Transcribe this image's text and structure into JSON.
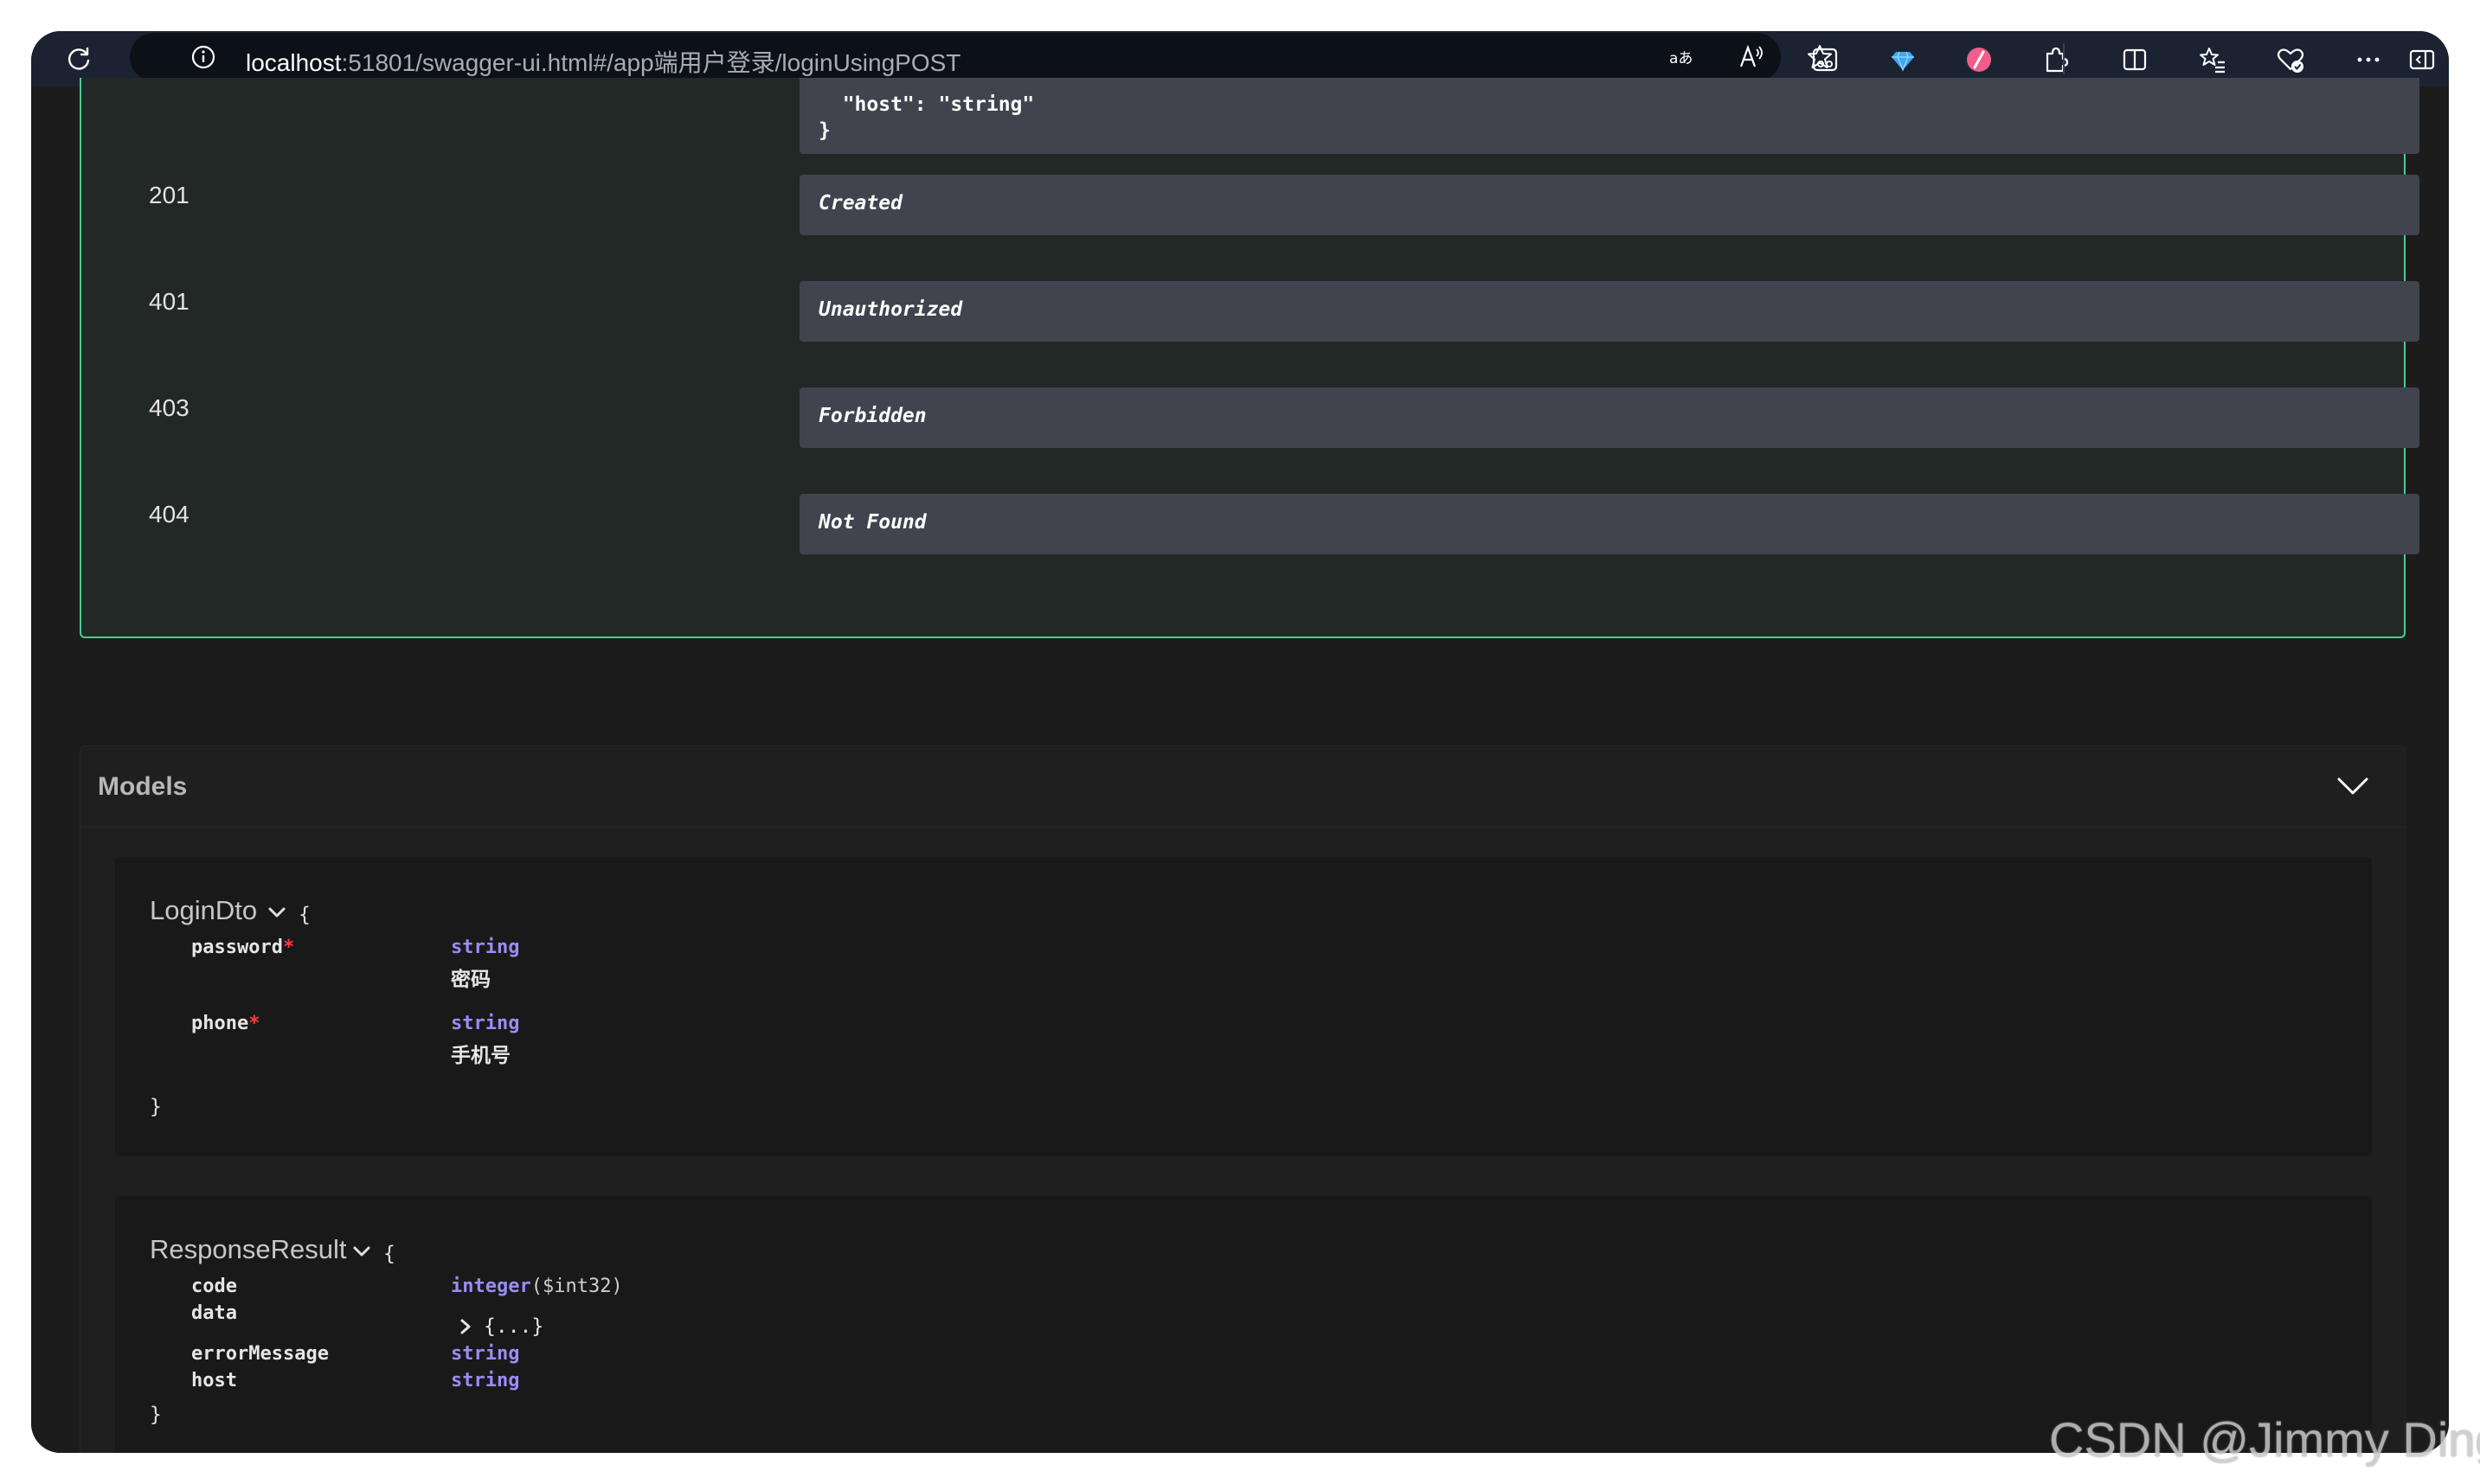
{
  "browser": {
    "url_host": "localhost",
    "url_rest": ":51801/swagger-ui.html#/app端用户登录/loginUsingPOST",
    "icons": [
      "refresh-icon",
      "site-info-icon",
      "translate-icon",
      "read-aloud-icon",
      "favorite-star-icon",
      "reading-mode-icon",
      "gem-extension-icon",
      "slash-extension-icon",
      "extensions-icon",
      "split-screen-icon",
      "favorites-icon",
      "browser-essentials-icon",
      "more-icon",
      "sidebar-icon"
    ]
  },
  "responses": {
    "example_tail": "  \"host\": \"string\"\n}",
    "rows": [
      {
        "code": "201",
        "description": "Created"
      },
      {
        "code": "401",
        "description": "Unauthorized"
      },
      {
        "code": "403",
        "description": "Forbidden"
      },
      {
        "code": "404",
        "description": "Not Found"
      }
    ],
    "accent_color": "#49cc90"
  },
  "models": {
    "title": "Models",
    "items": [
      {
        "name": "LoginDto",
        "open_brace": "{",
        "close_brace": "}",
        "properties": [
          {
            "name": "password",
            "required": "*",
            "type": "string",
            "description": "密码"
          },
          {
            "name": "phone",
            "required": "*",
            "type": "string",
            "description": "手机号"
          }
        ]
      },
      {
        "name": "ResponseResult",
        "open_brace": "{",
        "close_brace": "}",
        "properties": [
          {
            "name": "code",
            "type": "integer",
            "format": "($int32)"
          },
          {
            "name": "data",
            "type": "{...}"
          },
          {
            "name": "errorMessage",
            "type": "string"
          },
          {
            "name": "host",
            "type": "string"
          }
        ]
      }
    ]
  },
  "watermark": "CSDN @Jimmy Ding"
}
